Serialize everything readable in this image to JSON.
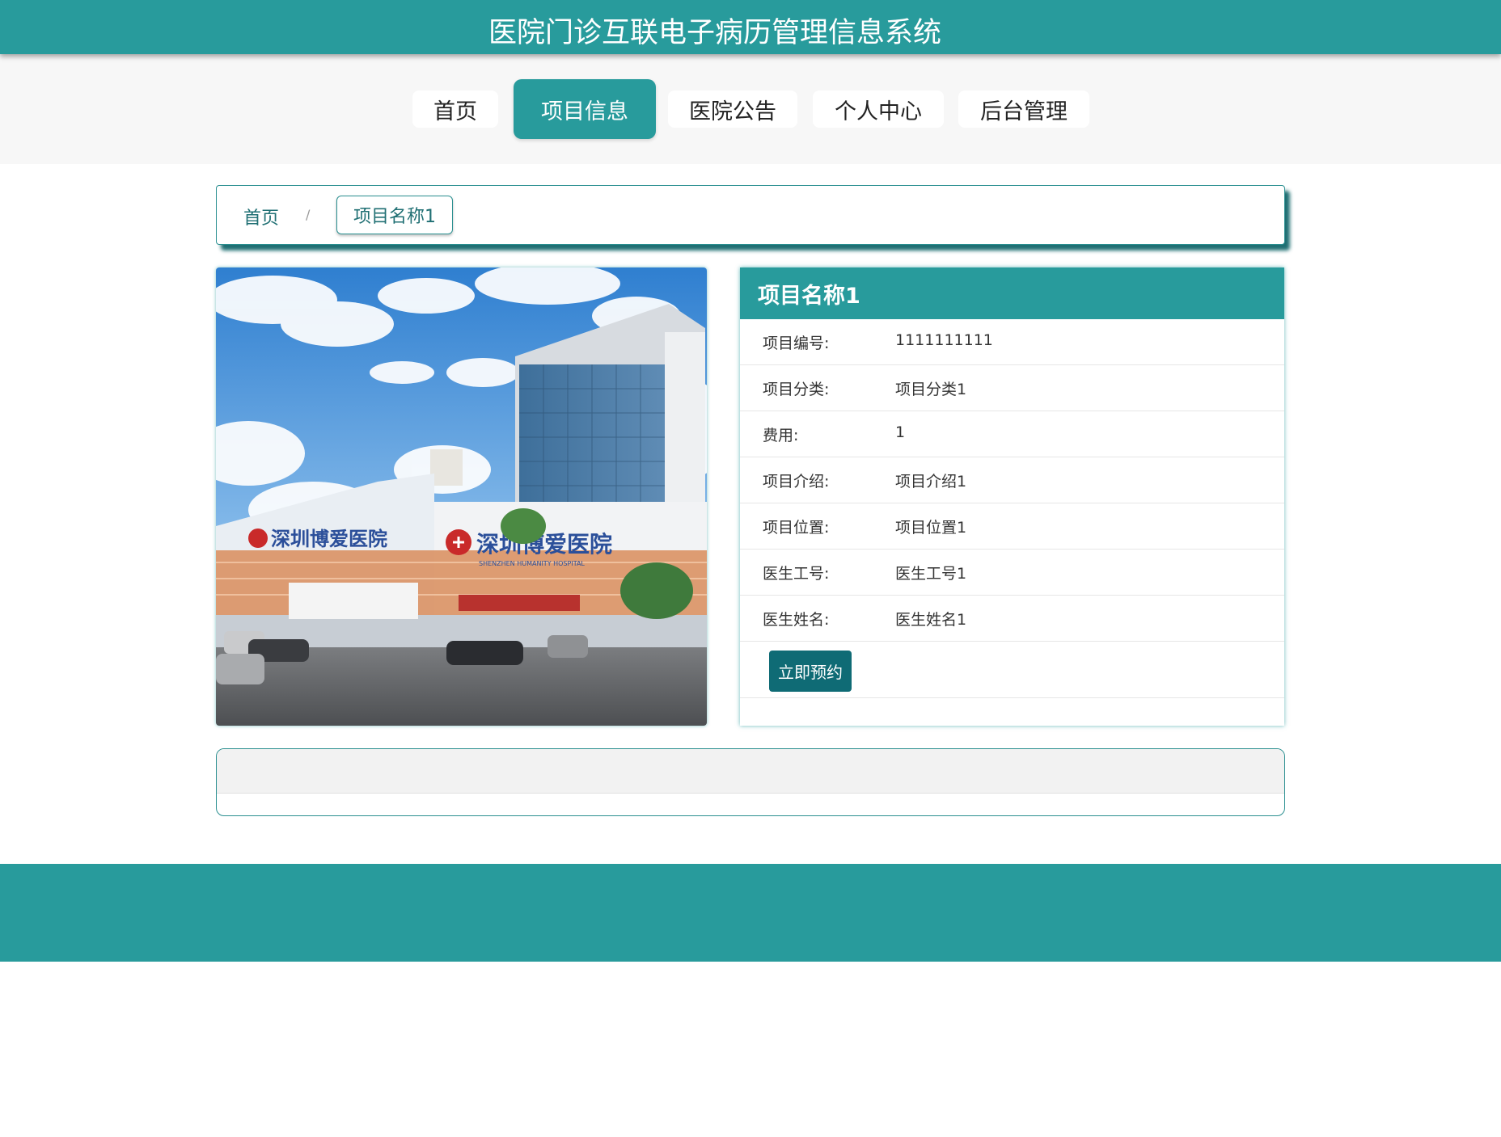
{
  "header": {
    "title": "医院门诊互联电子病历管理信息系统"
  },
  "nav": {
    "items": [
      {
        "label": "首页"
      },
      {
        "label": "项目信息"
      },
      {
        "label": "医院公告"
      },
      {
        "label": "个人中心"
      },
      {
        "label": "后台管理"
      }
    ]
  },
  "breadcrumb": {
    "home": "首页",
    "separator": "/",
    "current": "项目名称1"
  },
  "detail": {
    "title": "项目名称1",
    "fields": [
      {
        "label": "项目编号:",
        "value": "1111111111"
      },
      {
        "label": "项目分类:",
        "value": "项目分类1"
      },
      {
        "label": "费用:",
        "value": "1"
      },
      {
        "label": "项目介绍:",
        "value": "项目介绍1"
      },
      {
        "label": "项目位置:",
        "value": "项目位置1"
      },
      {
        "label": "医生工号:",
        "value": "医生工号1"
      },
      {
        "label": "医生姓名:",
        "value": "医生姓名1"
      }
    ],
    "book_button": "立即预约"
  },
  "photo": {
    "sign_text": "深圳博爱医院",
    "sign_subtext": "SHENZHEN HUMANITY HOSPITAL"
  },
  "colors": {
    "primary": "#289b9c",
    "dark": "#0f6b75"
  }
}
